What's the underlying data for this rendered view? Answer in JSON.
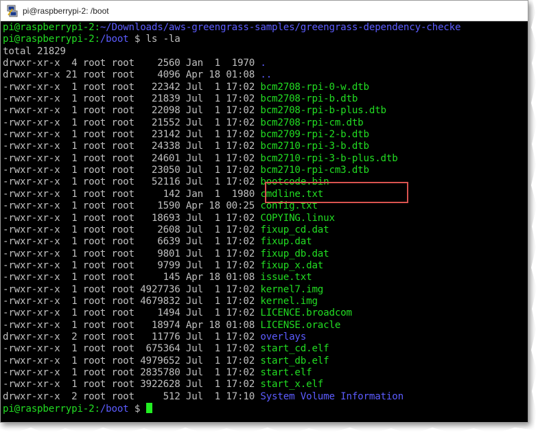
{
  "window": {
    "title": "pi@raspberrypi-2: /boot"
  },
  "terminal": {
    "lines": [
      {
        "type": "prompt",
        "user": "pi@raspberrypi-2:",
        "path": "~/Downloads/aws-greengrass-samples/greengrass-dependency-checke",
        "cmd": ""
      },
      {
        "type": "prompt",
        "user": "pi@raspberrypi-2:",
        "path": "/boot",
        "cmd": " $ ls -la"
      },
      {
        "type": "plain",
        "text": "total 21829"
      },
      {
        "type": "entry",
        "meta": "drwxr-xr-x  4 root root    2560 Jan  1  1970 ",
        "name": ".",
        "kind": "dir"
      },
      {
        "type": "entry",
        "meta": "drwxr-xr-x 21 root root    4096 Apr 18 01:08 ",
        "name": "..",
        "kind": "dir"
      },
      {
        "type": "entry",
        "meta": "-rwxr-xr-x  1 root root   22342 Jul  1 17:02 ",
        "name": "bcm2708-rpi-0-w.dtb",
        "kind": "file"
      },
      {
        "type": "entry",
        "meta": "-rwxr-xr-x  1 root root   21839 Jul  1 17:02 ",
        "name": "bcm2708-rpi-b.dtb",
        "kind": "file"
      },
      {
        "type": "entry",
        "meta": "-rwxr-xr-x  1 root root   22098 Jul  1 17:02 ",
        "name": "bcm2708-rpi-b-plus.dtb",
        "kind": "file"
      },
      {
        "type": "entry",
        "meta": "-rwxr-xr-x  1 root root   21552 Jul  1 17:02 ",
        "name": "bcm2708-rpi-cm.dtb",
        "kind": "file"
      },
      {
        "type": "entry",
        "meta": "-rwxr-xr-x  1 root root   23142 Jul  1 17:02 ",
        "name": "bcm2709-rpi-2-b.dtb",
        "kind": "file"
      },
      {
        "type": "entry",
        "meta": "-rwxr-xr-x  1 root root   24338 Jul  1 17:02 ",
        "name": "bcm2710-rpi-3-b.dtb",
        "kind": "file"
      },
      {
        "type": "entry",
        "meta": "-rwxr-xr-x  1 root root   24601 Jul  1 17:02 ",
        "name": "bcm2710-rpi-3-b-plus.dtb",
        "kind": "file"
      },
      {
        "type": "entry",
        "meta": "-rwxr-xr-x  1 root root   23050 Jul  1 17:02 ",
        "name": "bcm2710-rpi-cm3.dtb",
        "kind": "file"
      },
      {
        "type": "entry",
        "meta": "-rwxr-xr-x  1 root root   52116 Jul  1 17:02 ",
        "name": "bootcode.bin",
        "kind": "file"
      },
      {
        "type": "entry",
        "meta": "-rwxr-xr-x  1 root root     142 Jan  1  1980 ",
        "name": "cmdline.txt",
        "kind": "file"
      },
      {
        "type": "entry",
        "meta": "-rwxr-xr-x  1 root root    1590 Apr 18 00:25 ",
        "name": "config.txt",
        "kind": "file"
      },
      {
        "type": "entry",
        "meta": "-rwxr-xr-x  1 root root   18693 Jul  1 17:02 ",
        "name": "COPYING.linux",
        "kind": "file"
      },
      {
        "type": "entry",
        "meta": "-rwxr-xr-x  1 root root    2608 Jul  1 17:02 ",
        "name": "fixup_cd.dat",
        "kind": "file"
      },
      {
        "type": "entry",
        "meta": "-rwxr-xr-x  1 root root    6639 Jul  1 17:02 ",
        "name": "fixup.dat",
        "kind": "file"
      },
      {
        "type": "entry",
        "meta": "-rwxr-xr-x  1 root root    9801 Jul  1 17:02 ",
        "name": "fixup_db.dat",
        "kind": "file"
      },
      {
        "type": "entry",
        "meta": "-rwxr-xr-x  1 root root    9799 Jul  1 17:02 ",
        "name": "fixup_x.dat",
        "kind": "file"
      },
      {
        "type": "entry",
        "meta": "-rwxr-xr-x  1 root root     145 Apr 18 01:08 ",
        "name": "issue.txt",
        "kind": "file"
      },
      {
        "type": "entry",
        "meta": "-rwxr-xr-x  1 root root 4927736 Jul  1 17:02 ",
        "name": "kernel7.img",
        "kind": "file"
      },
      {
        "type": "entry",
        "meta": "-rwxr-xr-x  1 root root 4679832 Jul  1 17:02 ",
        "name": "kernel.img",
        "kind": "file"
      },
      {
        "type": "entry",
        "meta": "-rwxr-xr-x  1 root root    1494 Jul  1 17:02 ",
        "name": "LICENCE.broadcom",
        "kind": "file"
      },
      {
        "type": "entry",
        "meta": "-rwxr-xr-x  1 root root   18974 Apr 18 01:08 ",
        "name": "LICENSE.oracle",
        "kind": "file"
      },
      {
        "type": "entry",
        "meta": "drwxr-xr-x  2 root root   11776 Jul  1 17:02 ",
        "name": "overlays",
        "kind": "dir"
      },
      {
        "type": "entry",
        "meta": "-rwxr-xr-x  1 root root  675364 Jul  1 17:02 ",
        "name": "start_cd.elf",
        "kind": "file"
      },
      {
        "type": "entry",
        "meta": "-rwxr-xr-x  1 root root 4979652 Jul  1 17:02 ",
        "name": "start_db.elf",
        "kind": "file"
      },
      {
        "type": "entry",
        "meta": "-rwxr-xr-x  1 root root 2835780 Jul  1 17:02 ",
        "name": "start.elf",
        "kind": "file"
      },
      {
        "type": "entry",
        "meta": "-rwxr-xr-x  1 root root 3922628 Jul  1 17:02 ",
        "name": "start_x.elf",
        "kind": "file"
      },
      {
        "type": "entry",
        "meta": "drwxr-xr-x  2 root root     512 Jul  1 17:10 ",
        "name": "System Volume Information",
        "kind": "dir"
      },
      {
        "type": "prompt_cursor",
        "user": "pi@raspberrypi-2:",
        "path": "/boot",
        "cmd": " $ "
      }
    ]
  },
  "colors": {
    "terminal_bg": "#000000",
    "prompt_green": "#22dd22",
    "path_blue": "#5c5cff",
    "text_gray": "#c0c0c0",
    "highlight_red": "#d9534f"
  },
  "icons": {
    "app": "putty-icon"
  }
}
